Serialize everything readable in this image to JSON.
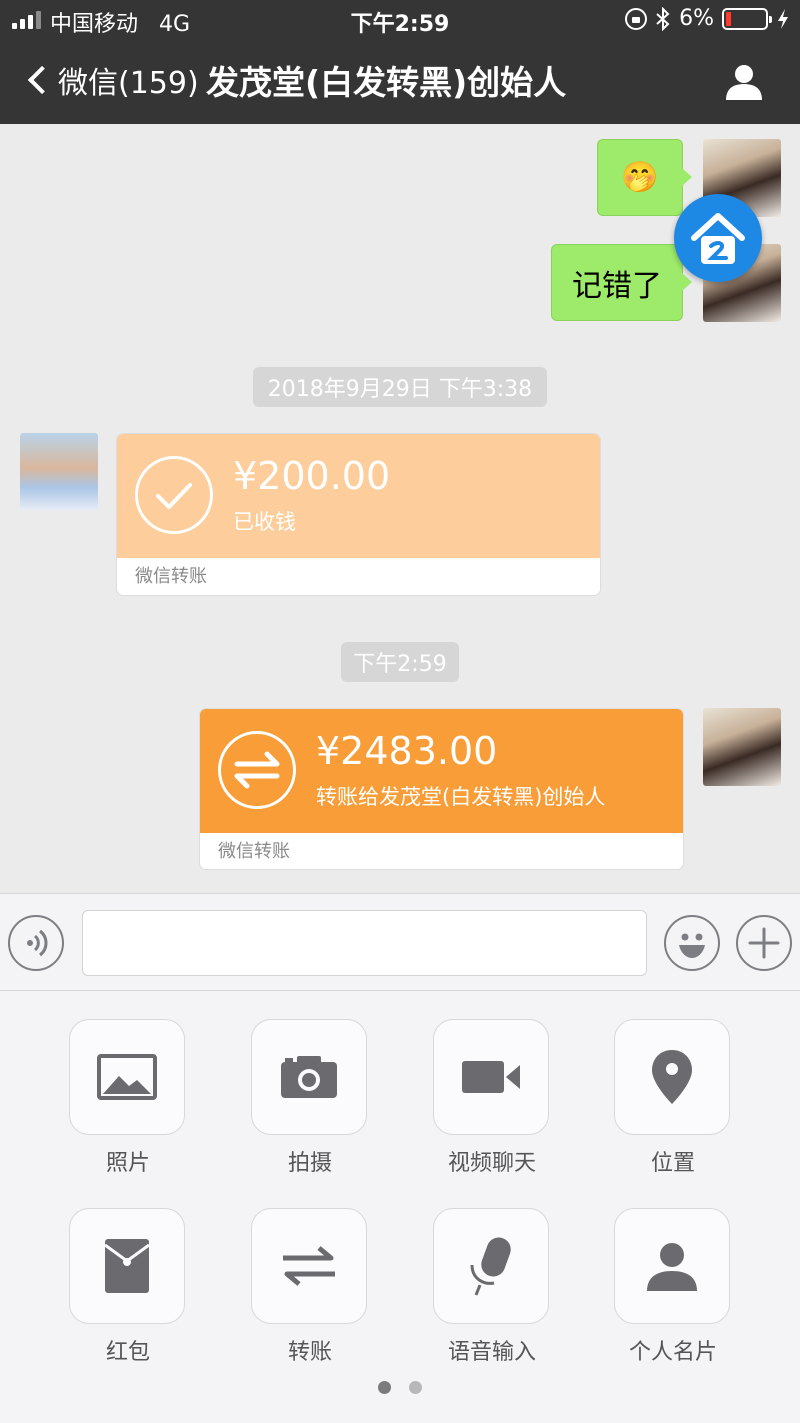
{
  "status_bar": {
    "carrier": "中国移动",
    "network": "4G",
    "time": "下午2:59",
    "battery": "6%"
  },
  "nav": {
    "back_label": "微信(159)",
    "title": "发茂堂(白发转黑)创始人"
  },
  "messages": {
    "m1_emoji": "🤭",
    "m2_text": "记错了",
    "time1": "2018年9月29日 下午3:38",
    "transfer1": {
      "amount": "¥200.00",
      "status": "已收钱",
      "footer": "微信转账"
    },
    "time2": "下午2:59",
    "transfer2": {
      "amount": "¥2483.00",
      "note": "转账给发茂堂(白发转黑)创始人",
      "footer": "微信转账"
    }
  },
  "input": {
    "placeholder": ""
  },
  "tools": [
    {
      "label": "照片",
      "icon": "photo-icon"
    },
    {
      "label": "拍摄",
      "icon": "camera-icon"
    },
    {
      "label": "视频聊天",
      "icon": "video-icon"
    },
    {
      "label": "位置",
      "icon": "location-icon"
    },
    {
      "label": "红包",
      "icon": "red-packet-icon"
    },
    {
      "label": "转账",
      "icon": "transfer-icon"
    },
    {
      "label": "语音输入",
      "icon": "microphone-icon"
    },
    {
      "label": "个人名片",
      "icon": "contact-card-icon"
    }
  ],
  "colors": {
    "header": "#353535",
    "bubble_green": "#9eea6a",
    "transfer_received": "#fdce9b",
    "transfer_sent": "#f89d37",
    "chat_bg": "#ebebeb"
  }
}
